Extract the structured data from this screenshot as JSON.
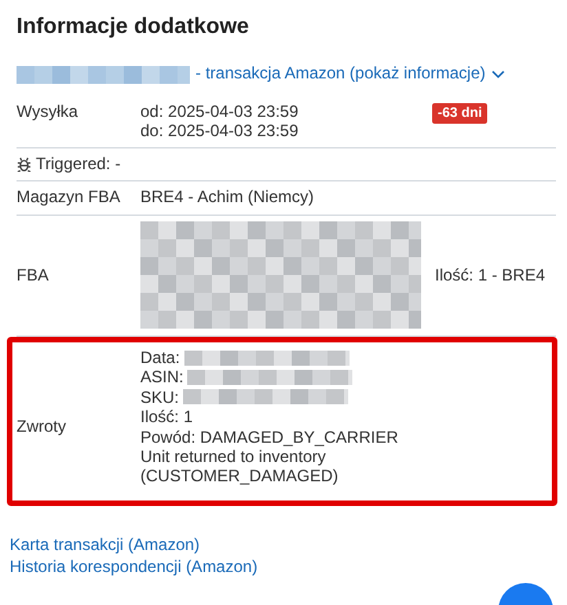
{
  "title": "Informacje dodatkowe",
  "transaction_link": {
    "redacted_prefix": true,
    "text": "- transakcja Amazon (pokaż informacje)",
    "expanded": false
  },
  "rows": [
    {
      "kind": "dates",
      "label": "Wysyłka",
      "lines": [
        "od: 2025-04-03 23:59",
        "do: 2025-04-03 23:59"
      ],
      "badge": "-63 dni"
    },
    {
      "kind": "note",
      "label": "Triggered: -"
    },
    {
      "kind": "text",
      "label": "Magazyn FBA",
      "value": "BRE4 - Achim (Niemcy)"
    },
    {
      "kind": "fba",
      "label": "FBA",
      "extra": "Ilość: 1 - BRE4"
    },
    {
      "kind": "returns",
      "label": "Zwroty",
      "highlighted": true,
      "lines": [
        {
          "text": "Data:",
          "redacted": true
        },
        {
          "text": "ASIN:",
          "redacted": true
        },
        {
          "text": "SKU:",
          "redacted": true
        },
        {
          "text": "Ilość: 1",
          "redacted": false
        },
        {
          "text": "Powód: DAMAGED_BY_CARRIER",
          "redacted": false
        },
        {
          "text": "Unit returned to inventory",
          "redacted": false
        },
        {
          "text": "(CUSTOMER_DAMAGED)",
          "redacted": false
        }
      ]
    }
  ],
  "links": [
    "Karta transakcji (Amazon)",
    "Historia korespondencji (Amazon)"
  ]
}
